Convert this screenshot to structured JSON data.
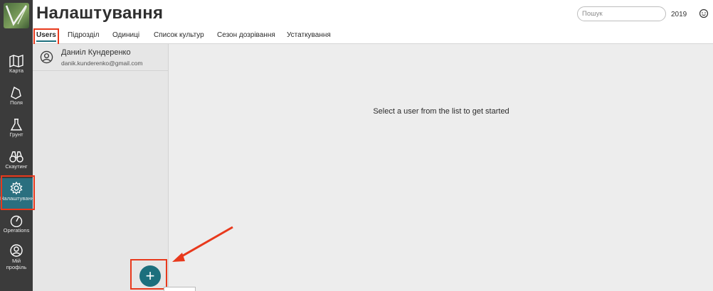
{
  "header": {
    "title": "Налаштування",
    "search_placeholder": "Пошук",
    "year": "2019"
  },
  "tabs": [
    {
      "label": "Users",
      "active": true
    },
    {
      "label": "Підрозділ"
    },
    {
      "label": "Одиниці"
    },
    {
      "label": "Список культур"
    },
    {
      "label": "Сезон дозрівання"
    },
    {
      "label": "Устаткування"
    }
  ],
  "sidebar": {
    "items": [
      {
        "label": "Карта",
        "icon": "map-icon"
      },
      {
        "label": "Поля",
        "icon": "field-icon"
      },
      {
        "label": "Грунт",
        "icon": "flask-icon"
      },
      {
        "label": "Скаутинг",
        "icon": "binoculars-icon"
      },
      {
        "label": "Налаштування",
        "icon": "gear-icon",
        "active": true
      },
      {
        "label": "Operations",
        "icon": "gauge-icon"
      },
      {
        "label": "Мій профіль",
        "icon": "user-circle-icon"
      }
    ]
  },
  "users": [
    {
      "name": "Даниіл Кундеренко",
      "email": "danik.kunderenko@gmail.com"
    }
  ],
  "main": {
    "empty_message": "Select a user from the list to get started"
  },
  "fab": {
    "symbol": "+"
  },
  "colors": {
    "accent": "#1c6f7d",
    "sidebar_bg": "#3b3b3b",
    "highlight": "#e8391c"
  }
}
